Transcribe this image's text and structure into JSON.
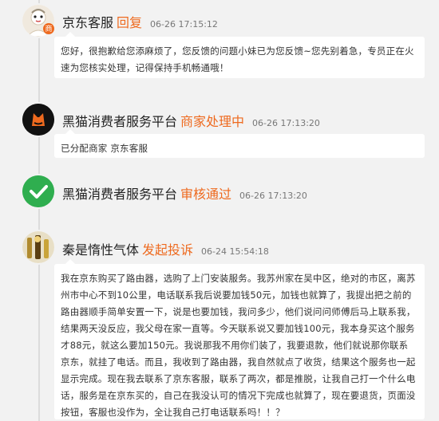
{
  "colors": {
    "accent": "#ee6a1f",
    "timeline": "#dcdcdc",
    "check_green": "#2fae4f"
  },
  "entries": [
    {
      "name": "京东客服",
      "action": "回复",
      "time": "06-26 17:15:12",
      "avatar_icon": "jd-service-avatar",
      "text": "您好，很抱歉给您添麻烦了，您反馈的问题小妹已为您反馈~您先别着急，专员正在火速为您核实处理，记得保持手机畅通哦！"
    },
    {
      "name": "黑猫消费者服务平台",
      "action": "商家处理中",
      "time": "06-26 17:13:20",
      "avatar_icon": "black-cat-icon",
      "text": "已分配商家 京东客服"
    },
    {
      "name": "黑猫消费者服务平台",
      "action": "审核通过",
      "time": "06-26 17:13:20",
      "avatar_icon": "check-icon"
    },
    {
      "name": "秦是惰性气体",
      "action": "发起投诉",
      "time": "06-24 15:54:18",
      "avatar_icon": "user-avatar",
      "text": "我在京东购买了路由器，选购了上门安装服务。我苏州家在吴中区，绝对的市区，离苏州市中心不到10公里，电话联系我后说要加钱50元，加钱也就算了，我提出把之前的路由器顺手简单安置一下，说是也要加钱，我问多少，他们说问问师傅后马上联系我，结果两天没反应，我父母在家一直等。今天联系说又要加钱100元，我本身买这个服务才88元，就这么要加150元。我说那我不用你们装了，我要退款，他们就说那你联系京东，就挂了电话。而且，我收到了路由器，我自然就点了收货，结果这个服务也一起显示完成。现在我去联系了京东客服，联系了两次，都是推脱，让我自己打一个什么电话，服务是在京东买的，自己在我没认可的情况下完成也就算了，现在要退货，页面没按钮，客服也没作为，全让我自己打电话联系吗！！？"
    }
  ]
}
